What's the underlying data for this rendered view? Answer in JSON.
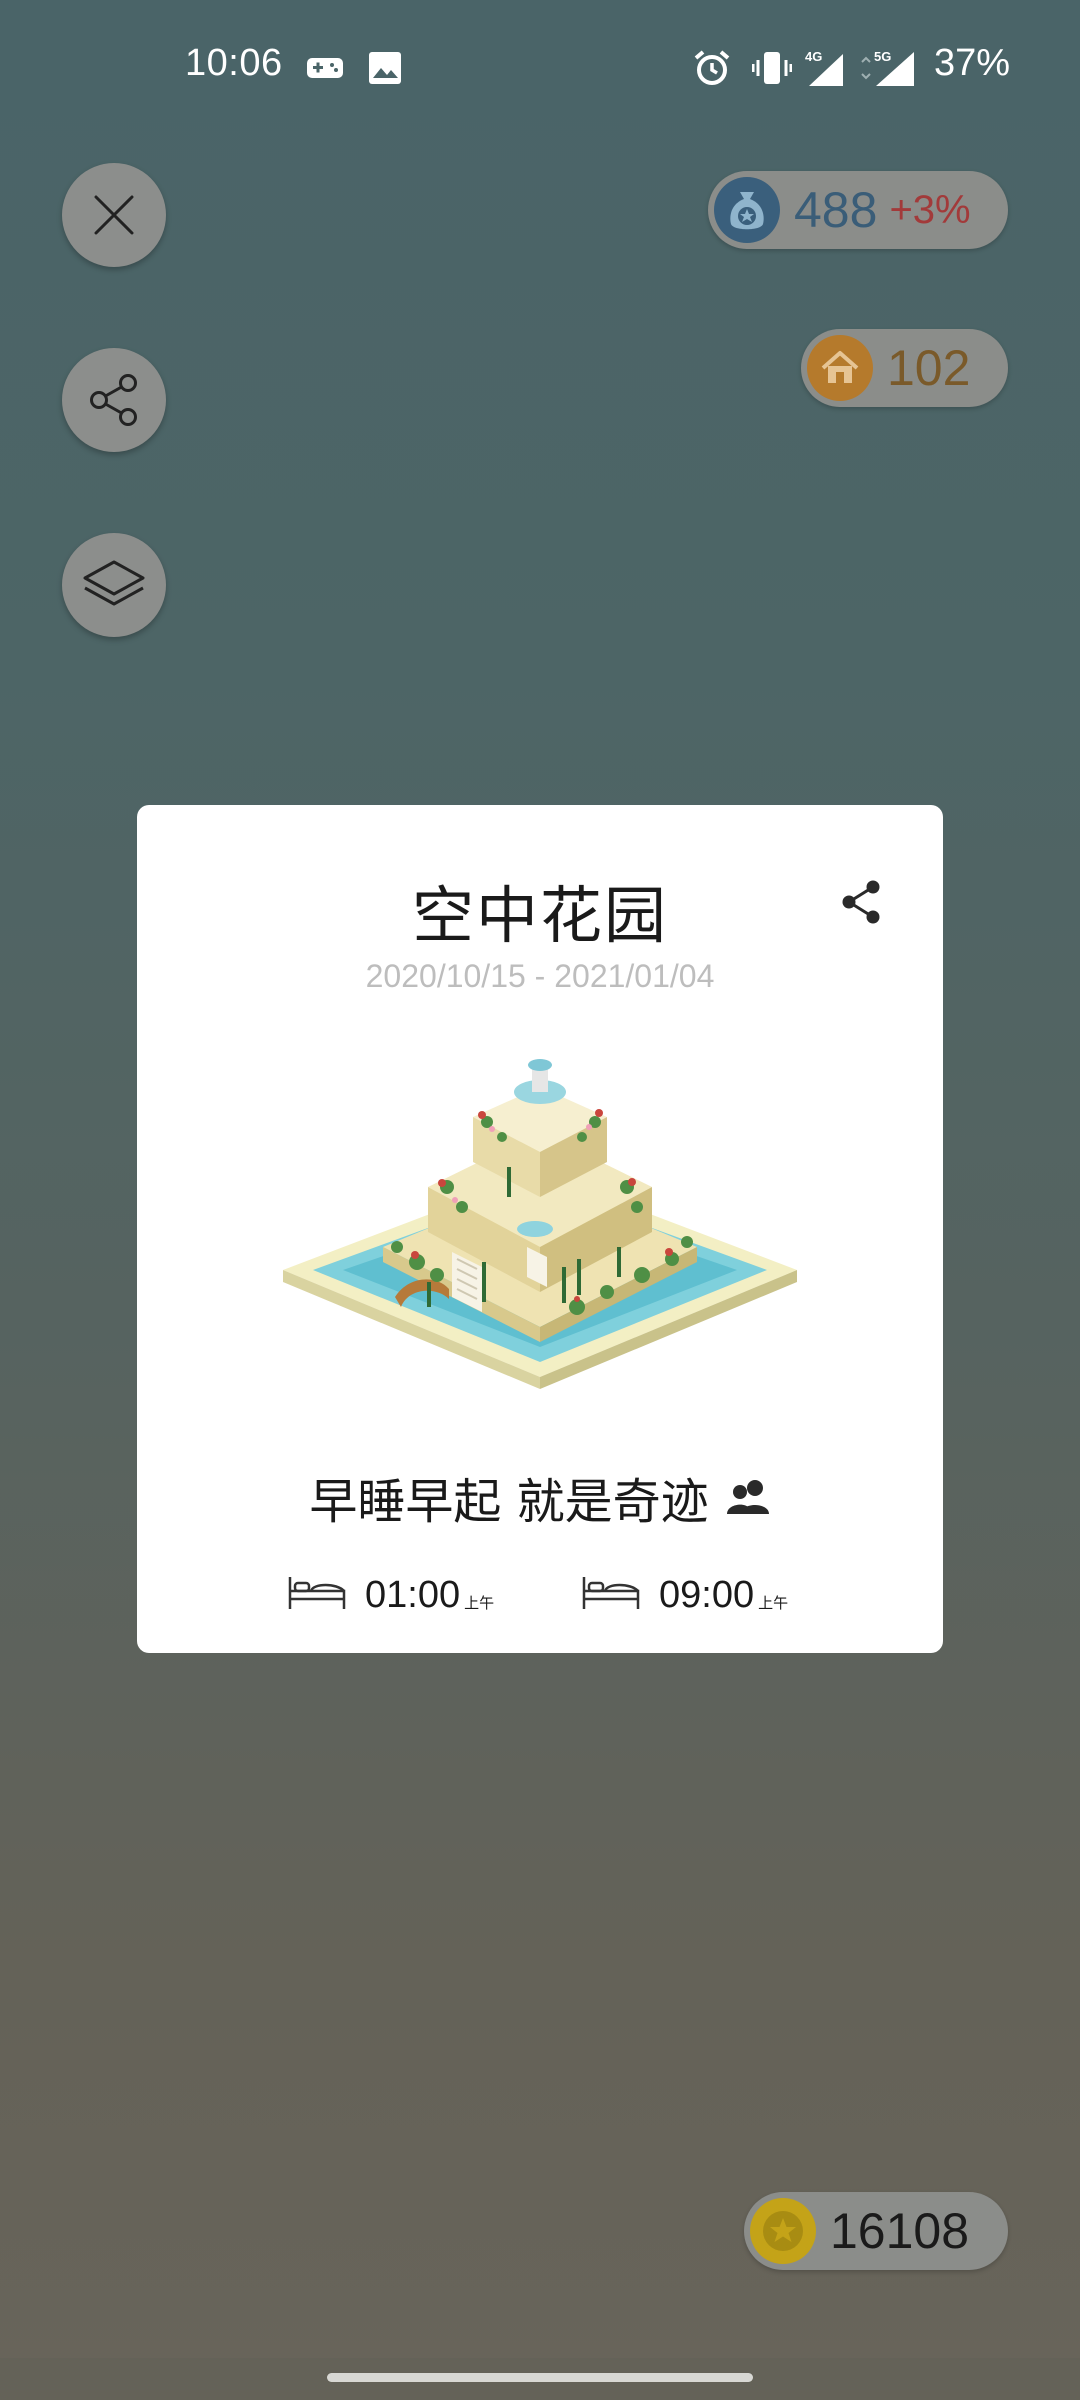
{
  "status_bar": {
    "time": "10:06",
    "battery": "37%",
    "network_4g": "4G",
    "network_5g": "5G",
    "icons": [
      "gamepad-icon",
      "image-icon",
      "alarm-icon",
      "vibrate-icon",
      "signal-4g-icon",
      "signal-5g-icon"
    ]
  },
  "side_buttons": {
    "close_icon": "close-icon",
    "share_icon": "share-icon",
    "layers_icon": "layers-icon"
  },
  "counters": {
    "reward": {
      "value": "488",
      "change": "+3%",
      "icon": "money-bag-icon",
      "value_color": "#3a5d78",
      "change_color": "#a23a3a"
    },
    "houses": {
      "value": "102",
      "icon": "house-icon",
      "value_color": "#7a5a2a"
    },
    "coins": {
      "value": "16108",
      "icon": "coin-icon",
      "value_color": "#1a1a1a"
    }
  },
  "card": {
    "title": "空中花园",
    "date_range": "2020/10/15 - 2021/01/04",
    "motto": "早睡早起 就是奇迹",
    "sleep_time": {
      "value": "01:00",
      "suffix": "上午"
    },
    "wake_time": {
      "value": "09:00",
      "suffix": "上午"
    }
  },
  "colors": {
    "card_background": "#ffffff",
    "button_background": "#8c8e8c",
    "pill_background": "#8b8d8a"
  }
}
